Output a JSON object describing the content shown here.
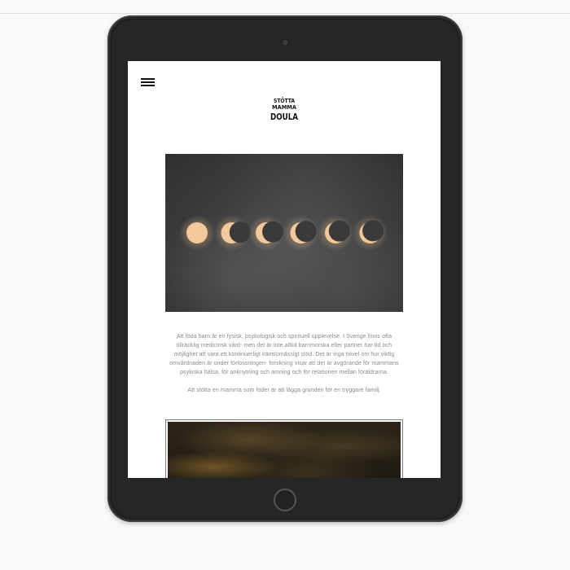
{
  "site": {
    "logo": {
      "line1": "STÖTTA",
      "line2": "MAMMA",
      "line3": "DOULA"
    },
    "menu_icon": "hamburger-menu-icon",
    "hero_image": {
      "description_icon": "moon-phases-image",
      "moon_phases": [
        {
          "phase": "full",
          "cover": 0.0
        },
        {
          "phase": "waning",
          "cover": 0.25
        },
        {
          "phase": "waning",
          "cover": 0.45
        },
        {
          "phase": "crescent",
          "cover": 0.62
        },
        {
          "phase": "crescent",
          "cover": 0.75
        },
        {
          "phase": "crescent",
          "cover": 0.86
        }
      ],
      "moon_color": "#f3c89a"
    },
    "paragraphs": [
      "Att föda barn är en fysisk, psykologisk och spirituell upplevelse. I Sverige finns ofta tillräcklig medicinsk vård- men det är inte alltid barnmorska eller partner har tid och möjlighet att vara ett kontinuerligt känslomässigt stöd. Det är inga tvivel om hur viktig omvårdnaden är under förlossningen- forskning visar att det är avgörande för mammans psykiska hälsa, för anknytning och amning och för relationen mellan föräldrarna.",
      "Att stötta en mamma som föder är att lägga grunden för en tryggare familj."
    ],
    "second_image": "forest-candle-image"
  },
  "colors": {
    "device_body": "#262626",
    "page_bg": "#f9f9f9",
    "text": "#8a8a8a",
    "accent_moon": "#f3c89a"
  }
}
